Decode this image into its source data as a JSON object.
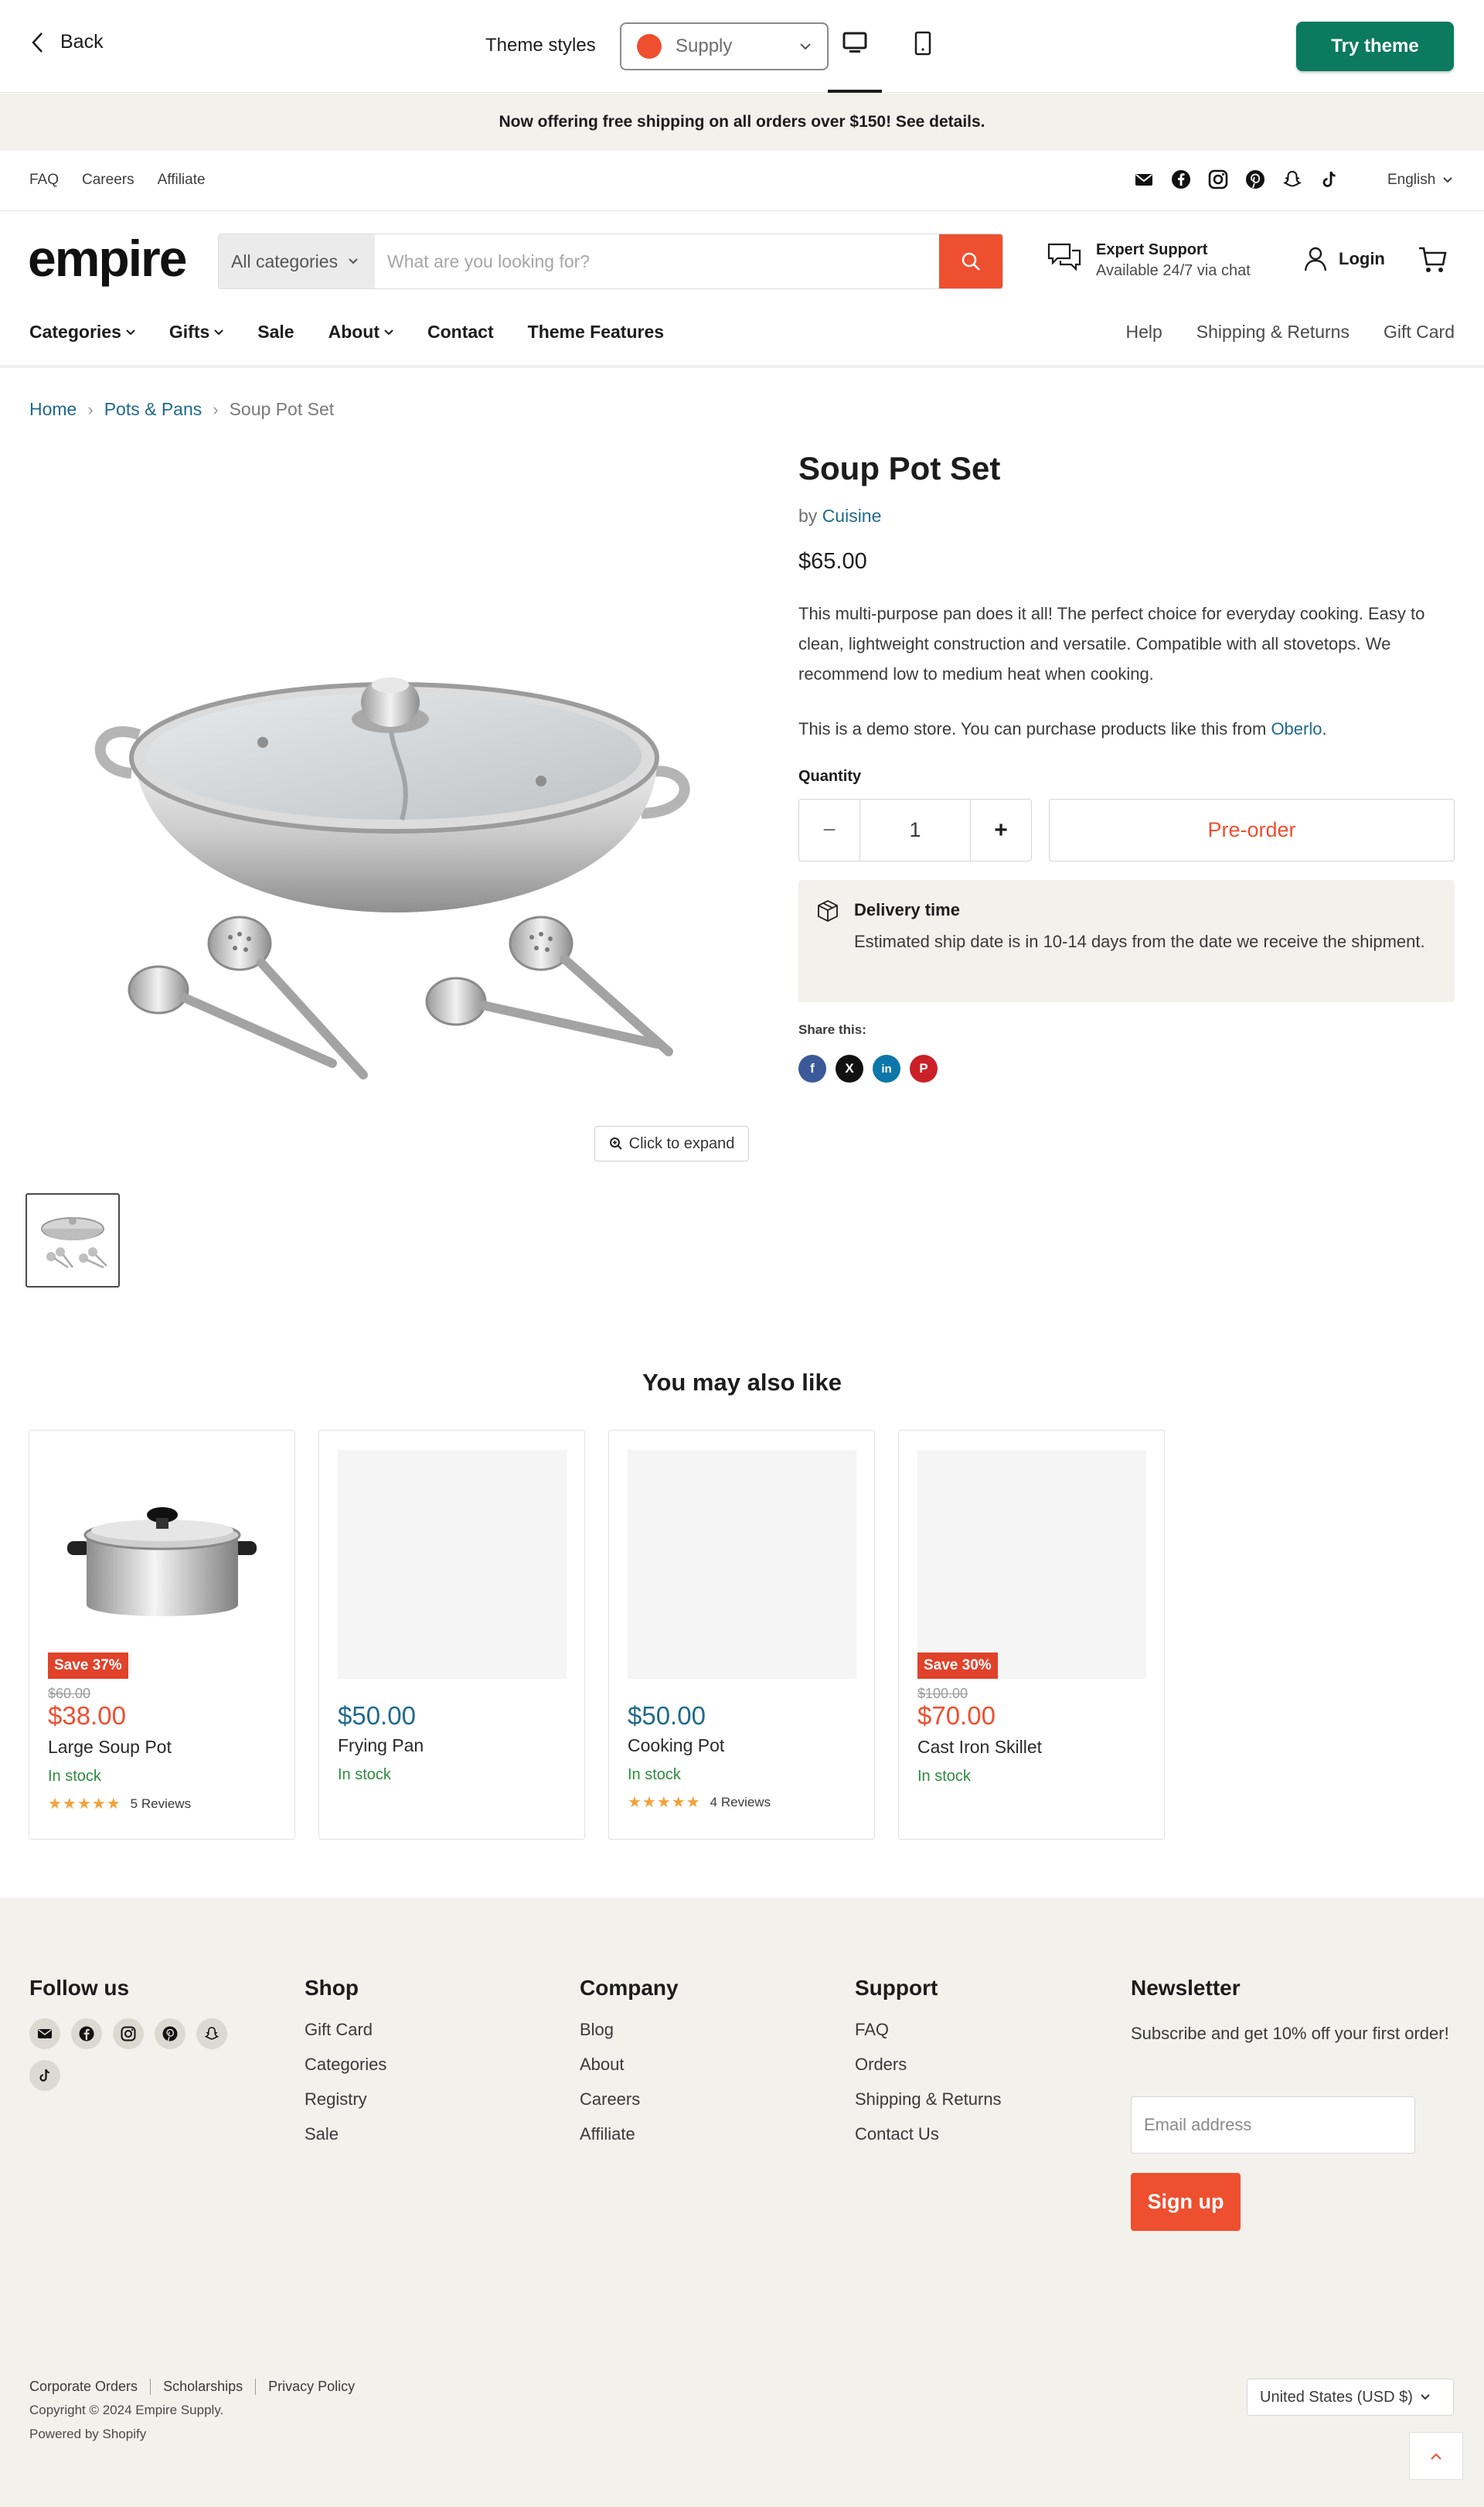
{
  "preview": {
    "back_label": "Back",
    "theme_styles_label": "Theme styles",
    "theme_selected": "Supply",
    "theme_color": "#ee4f2f",
    "try_theme_label": "Try theme"
  },
  "announcement": "Now offering free shipping on all orders over $150! See details.",
  "utility": {
    "links": [
      "FAQ",
      "Careers",
      "Affiliate"
    ],
    "social_icons": [
      "email-icon",
      "facebook-icon",
      "instagram-icon",
      "pinterest-icon",
      "snapchat-icon",
      "tiktok-icon"
    ],
    "language": "English"
  },
  "header": {
    "logo": "empire",
    "search_category": "All categories",
    "search_placeholder": "What are you looking for?",
    "support_title": "Expert Support",
    "support_subtitle": "Available 24/7 via chat",
    "login_label": "Login"
  },
  "nav": {
    "main": [
      "Categories",
      "Gifts",
      "Sale",
      "About",
      "Contact",
      "Theme Features"
    ],
    "secondary": [
      "Help",
      "Shipping & Returns",
      "Gift Card"
    ]
  },
  "breadcrumb": {
    "home": "Home",
    "collection": "Pots & Pans",
    "current": "Soup Pot Set"
  },
  "product": {
    "title": "Soup Pot Set",
    "by_label": "by",
    "vendor": "Cuisine",
    "price": "$65.00",
    "description": "This multi-purpose pan does it all! The perfect choice for everyday cooking. Easy to clean, lightweight construction and versatile. Compatible with all stovetops. We recommend low to medium heat when cooking.",
    "demo_prefix": "This is a demo store. You can purchase products like this from",
    "demo_link": "Oberlo",
    "demo_suffix": ".",
    "click_to_expand": "Click to expand",
    "quantity_label": "Quantity",
    "quantity_value": "1",
    "minus": "−",
    "plus": "+",
    "preorder_label": "Pre-order",
    "delivery_title": "Delivery time",
    "delivery_text": "Estimated ship date is in 10-14 days from the date we receive the shipment.",
    "share_label": "Share this:",
    "share_icons": [
      "facebook-icon",
      "x-icon",
      "linkedin-icon",
      "pinterest-icon"
    ]
  },
  "related": {
    "title": "You may also like",
    "items": [
      {
        "badge": "Save 37%",
        "was": "$60.00",
        "price": "$38.00",
        "name": "Large Soup Pot",
        "stock": "In stock",
        "stars": "★★★★★",
        "reviews": "5 Reviews"
      },
      {
        "price": "$50.00",
        "name": "Frying Pan",
        "stock": "In stock"
      },
      {
        "price": "$50.00",
        "name": "Cooking Pot",
        "stock": "In stock",
        "stars": "★★★★★",
        "reviews": "4 Reviews"
      },
      {
        "badge": "Save 30%",
        "was": "$100.00",
        "price": "$70.00",
        "name": "Cast Iron Skillet",
        "stock": "In stock"
      }
    ]
  },
  "footer": {
    "follow_title": "Follow us",
    "shop_title": "Shop",
    "shop_links": [
      "Gift Card",
      "Categories",
      "Registry",
      "Sale"
    ],
    "company_title": "Company",
    "company_links": [
      "Blog",
      "About",
      "Careers",
      "Affiliate"
    ],
    "support_title": "Support",
    "support_links": [
      "FAQ",
      "Orders",
      "Shipping & Returns",
      "Contact Us"
    ],
    "newsletter_title": "Newsletter",
    "newsletter_text": "Subscribe and get 10% off your first order!",
    "email_placeholder": "Email address",
    "signup_label": "Sign up",
    "bottom_links": [
      "Corporate Orders",
      "Scholarships",
      "Privacy Policy"
    ],
    "copyright": "Copyright © 2024 Empire Supply.",
    "powered": "Powered by Shopify",
    "currency": "United States (USD $)"
  }
}
